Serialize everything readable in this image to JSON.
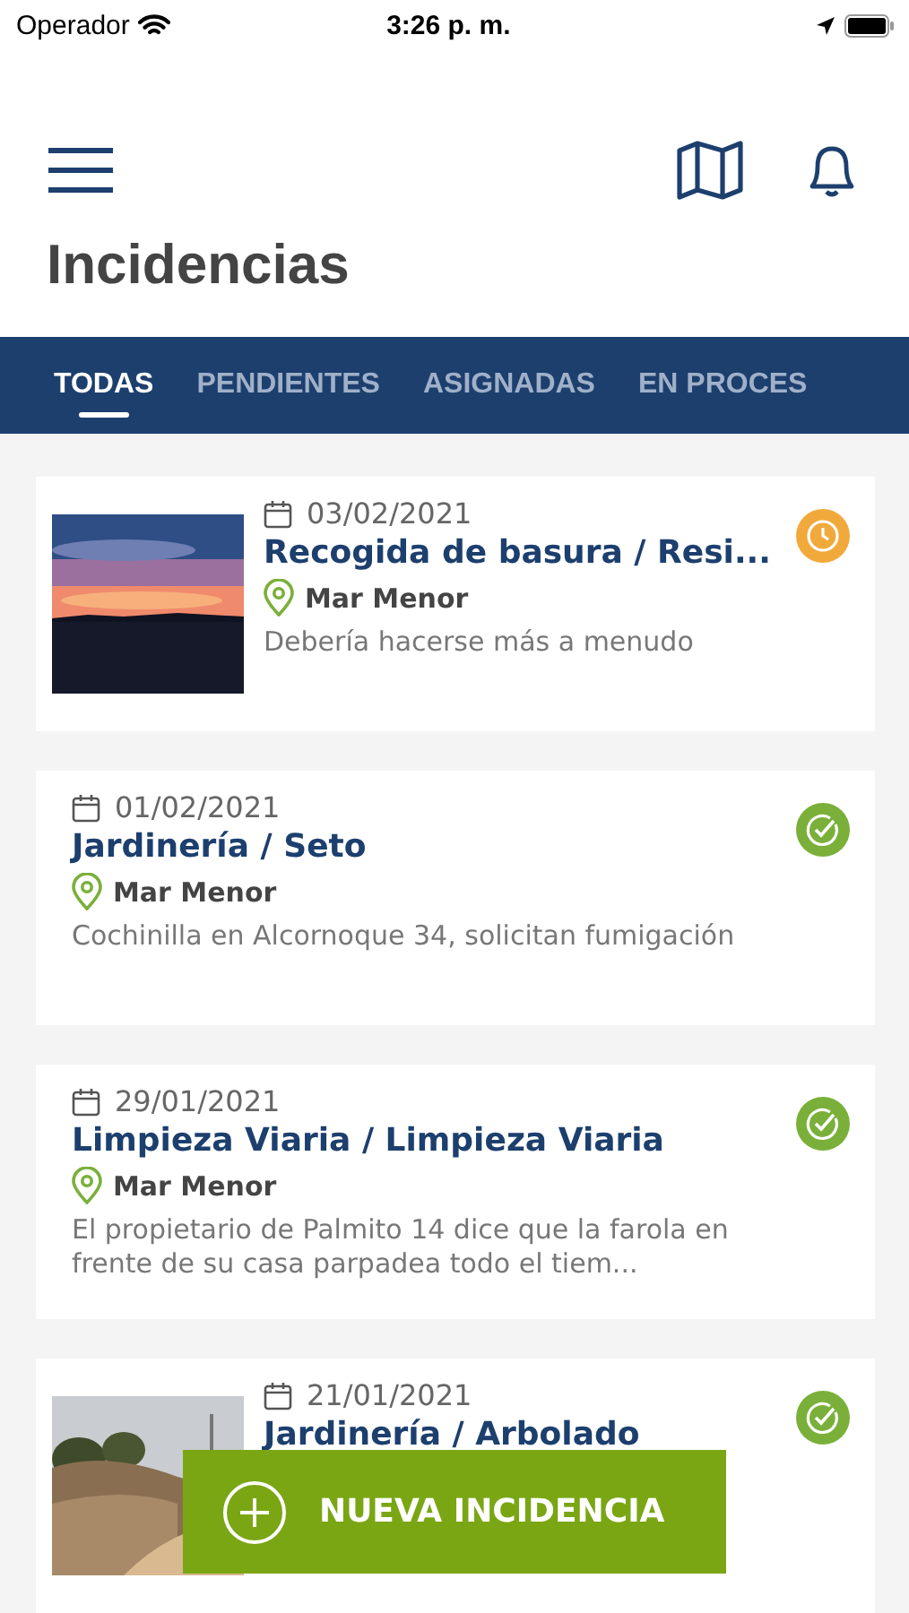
{
  "status_bar": {
    "carrier": "Operador",
    "time": "3:26 p. m."
  },
  "title": "Incidencias",
  "tabs": [
    {
      "label": "TODAS",
      "selected": true
    },
    {
      "label": "PENDIENTES",
      "selected": false
    },
    {
      "label": "ASIGNADAS",
      "selected": false
    },
    {
      "label": "EN PROCES",
      "selected": false
    }
  ],
  "incidents": [
    {
      "date": "03/02/2021",
      "title": "Recogida de basura / Resi...",
      "location": "Mar Menor",
      "description": "Debería hacerse más a menudo",
      "kind": "pending",
      "color": "#f2a93b"
    },
    {
      "date": "01/02/2021",
      "title": "Jardinería / Seto",
      "location": "Mar Menor",
      "description": "Cochinilla en Alcornoque 34, solicitan fumigación",
      "kind": "done",
      "color": "#7ab03a"
    },
    {
      "date": "29/01/2021",
      "title": "Limpieza Viaria / Limpieza Viaria",
      "location": "Mar Menor",
      "description": "El propietario de Palmito 14 dice que la farola en frente de su casa parpadea todo el tiem...",
      "kind": "done",
      "color": "#7ab03a"
    },
    {
      "date": "21/01/2021",
      "title": "Jardinería / Arbolado",
      "kind": "done",
      "color": "#7ab03a"
    }
  ],
  "new_button": {
    "label": "NUEVA INCIDENCIA"
  }
}
